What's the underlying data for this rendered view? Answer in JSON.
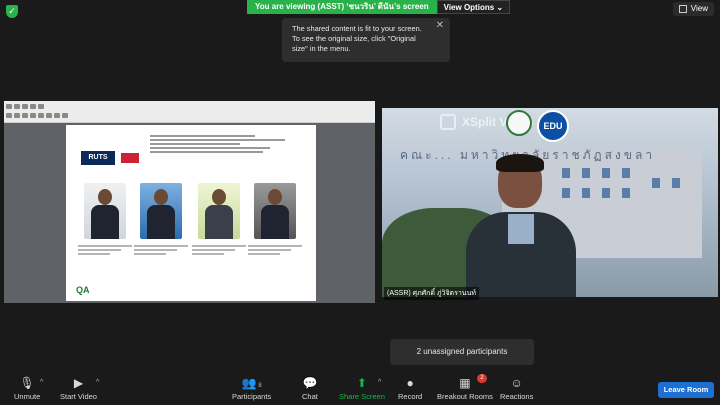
{
  "top_bar": {
    "viewing_text": "You are viewing (ASST) ‘ชนวริน’ ดีนัน’s screen",
    "view_options_label": "View Options",
    "view_label": "View"
  },
  "tooltip": {
    "text": "The shared content is fit to your screen. To see the original size, click \"Original size\" in the menu."
  },
  "shared_screen": {
    "logo_text": "RUTS",
    "footer_logo": "QA"
  },
  "video": {
    "overlay_brand": "XSplit VCam",
    "edu_badge": "EDU",
    "building_sign": "คณะ... มหาวิทยาลัยราชภัฏสงขลา",
    "participant_name": "(ASSR) ศุภศักดิ์ ภู่วิจิตรานนท์"
  },
  "popup": {
    "unassigned_text": "2 unassigned participants"
  },
  "toolbar": {
    "unmute": "Unmute",
    "start_video": "Start Video",
    "participants": "Participants",
    "participants_count": "8",
    "chat": "Chat",
    "share_screen": "Share Screen",
    "record": "Record",
    "breakout_rooms": "Breakout Rooms",
    "breakout_badge": "2",
    "reactions": "Reactions",
    "leave_room": "Leave Room"
  },
  "colors": {
    "banner_green": "#2ab24a",
    "leave_blue": "#1d6fd1",
    "share_green": "#1fb24b"
  }
}
